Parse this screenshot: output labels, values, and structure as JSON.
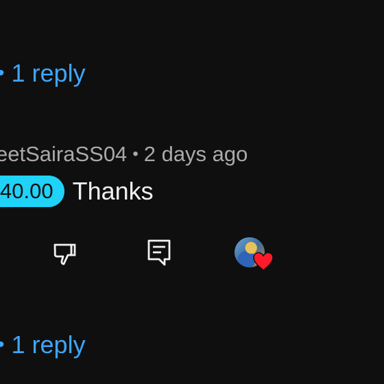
{
  "thread_top": {
    "bullet": "•",
    "reply_label": "1 reply"
  },
  "comment": {
    "username": "eetSairaSS04",
    "separator": "•",
    "time_ago": "2 days ago",
    "super_thanks_amount": "40.00",
    "text": "Thanks"
  },
  "actions": {
    "dislike_icon": "thumbs-down-icon",
    "reply_icon": "comment-reply-icon",
    "creator_heart_icon": "heart-icon",
    "heart_color": "#ff1a2b"
  },
  "thread_bottom": {
    "bullet": "•",
    "reply_label": "1 reply"
  },
  "colors": {
    "background": "#0f0f0f",
    "link": "#3ea6ff",
    "chip": "#1fd2f7",
    "meta_text": "#aaaaaa"
  }
}
